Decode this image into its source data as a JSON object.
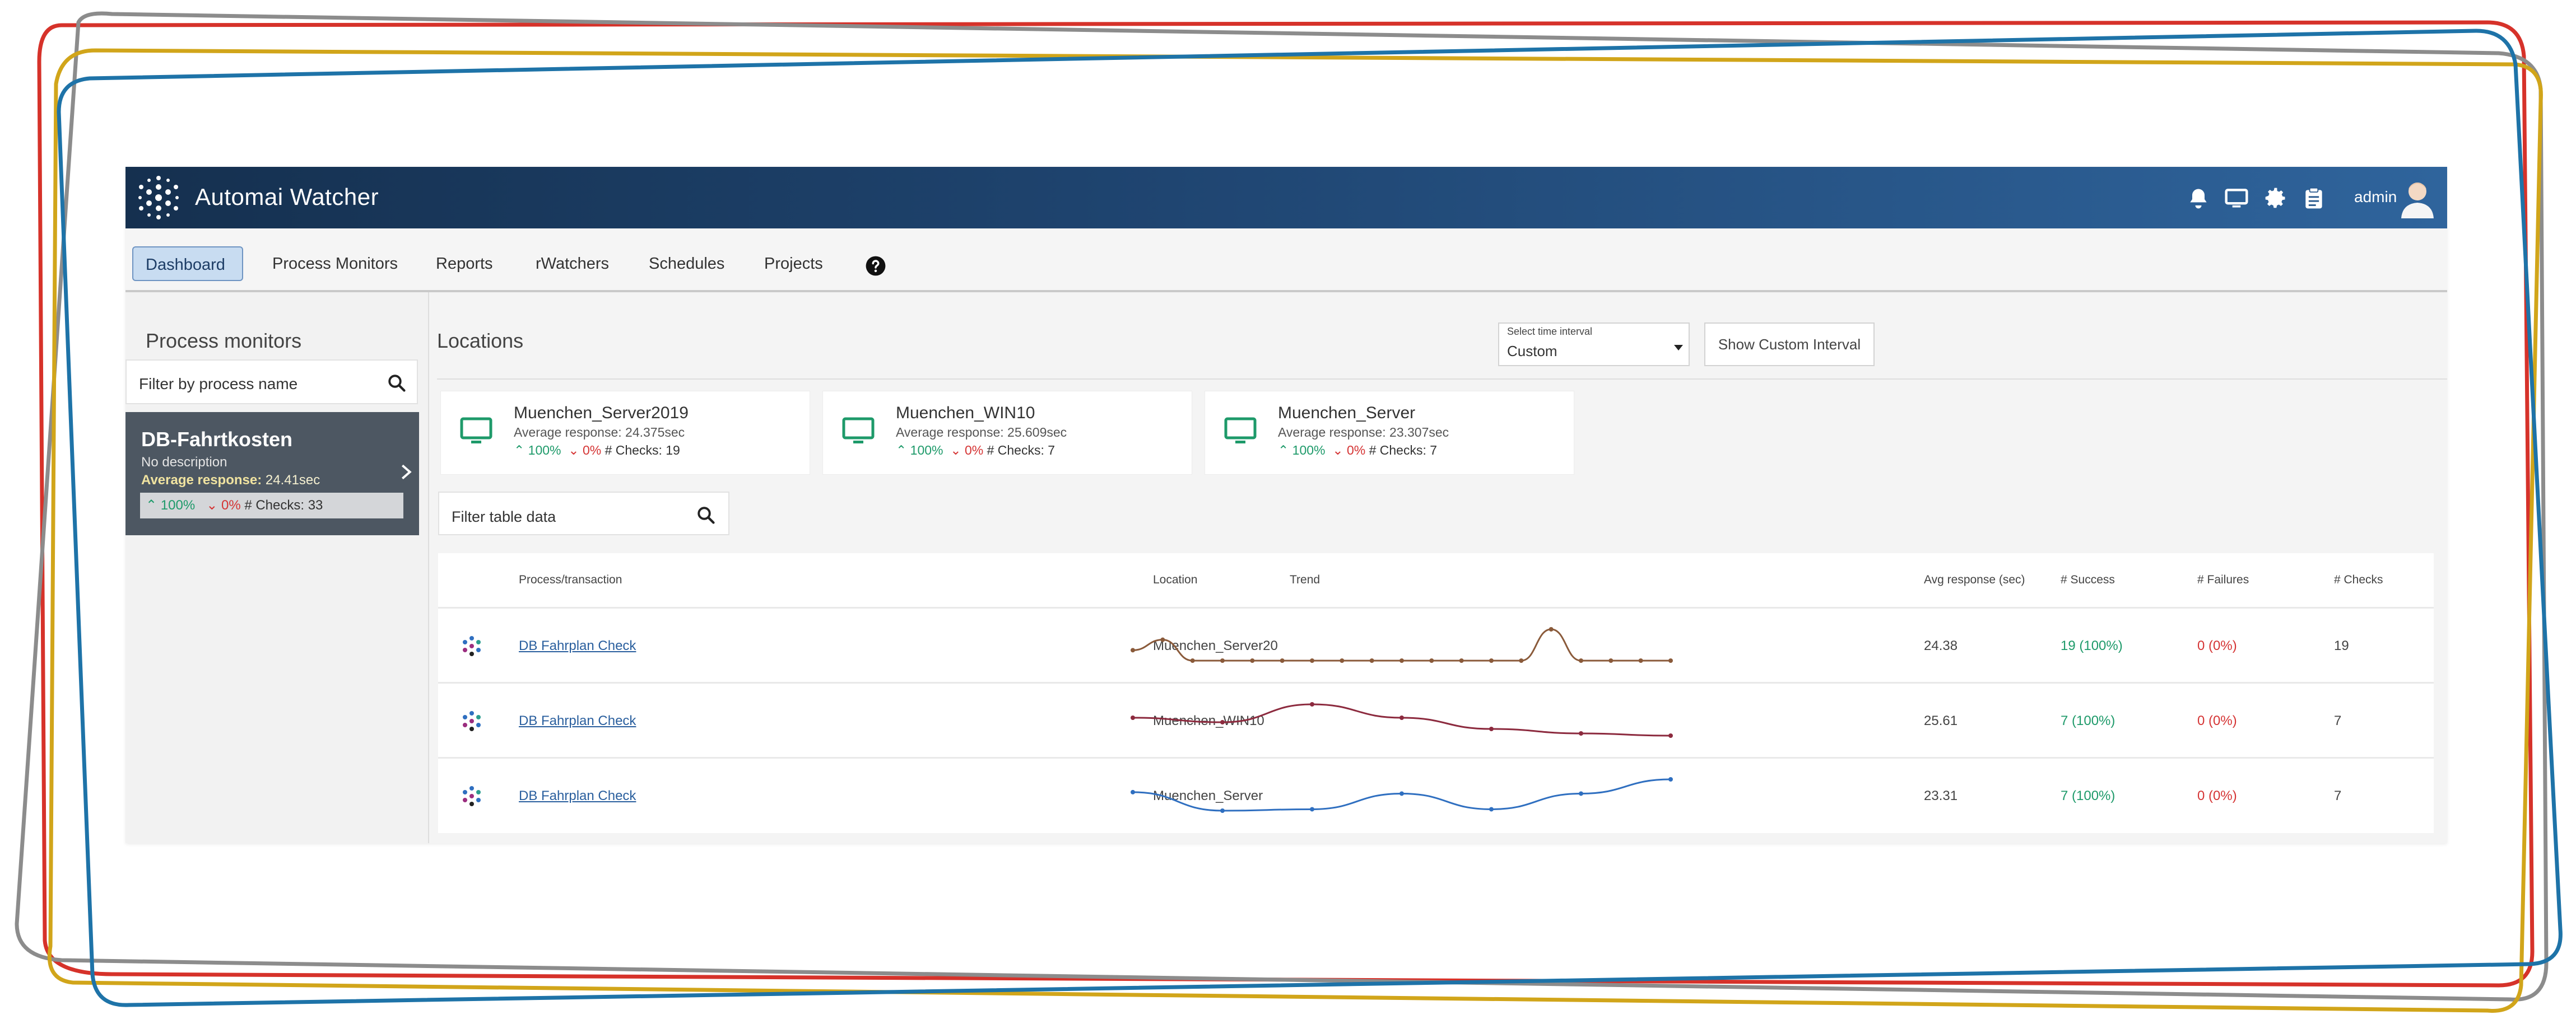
{
  "app": {
    "title": "Automai Watcher",
    "user": "admin"
  },
  "header_icons": [
    "bell-icon",
    "monitor-icon",
    "gear-icon",
    "clipboard-icon"
  ],
  "nav": {
    "items": [
      {
        "label": "Dashboard",
        "active": true
      },
      {
        "label": "Process Monitors",
        "active": false
      },
      {
        "label": "Reports",
        "active": false
      },
      {
        "label": "rWatchers",
        "active": false
      },
      {
        "label": "Schedules",
        "active": false
      },
      {
        "label": "Projects",
        "active": false
      }
    ],
    "help_icon": "question-circle-icon"
  },
  "process_monitors": {
    "title": "Process monitors",
    "filter_placeholder": "Filter by process name",
    "items": [
      {
        "name": "DB-Fahrtkosten",
        "description": "No description",
        "avg_label": "Average response:",
        "avg_value": "24.41sec",
        "success": "100%",
        "failure": "0%",
        "checks": "# Checks: 33"
      }
    ]
  },
  "locations": {
    "title": "Locations",
    "interval": {
      "label": "Select time interval",
      "value": "Custom"
    },
    "custom_button": "Show Custom Interval",
    "cards": [
      {
        "name": "Muenchen_Server2019",
        "avg": "Average response: 24.375sec",
        "success": "100%",
        "failure": "0%",
        "checks": "# Checks: 19"
      },
      {
        "name": "Muenchen_WIN10",
        "avg": "Average response: 25.609sec",
        "success": "100%",
        "failure": "0%",
        "checks": "# Checks: 7"
      },
      {
        "name": "Muenchen_Server",
        "avg": "Average response: 23.307sec",
        "success": "100%",
        "failure": "0%",
        "checks": "# Checks: 7"
      }
    ]
  },
  "table": {
    "filter_placeholder": "Filter table data",
    "headers": [
      "Process/transaction",
      "Location",
      "Trend",
      "Avg response (sec)",
      "# Success",
      "# Failures",
      "# Checks"
    ],
    "rows": [
      {
        "process": "DB Fahrplan Check",
        "location": "Muenchen_Server20",
        "avg": "24.38",
        "success": "19 (100%)",
        "failures": "0 (0%)",
        "checks": "19",
        "trend_color": "#8a5a3a",
        "trend": [
          26,
          28,
          24,
          24,
          24,
          24,
          24,
          24,
          24,
          24,
          24,
          24,
          24,
          24,
          30,
          24,
          24,
          24,
          24
        ]
      },
      {
        "process": "DB Fahrplan Check",
        "location": "Muenchen_WIN10",
        "avg": "25.61",
        "success": "7 (100%)",
        "failures": "0 (0%)",
        "checks": "7",
        "trend_color": "#8c2a3e",
        "trend": [
          26.0,
          25.6,
          27.2,
          26.0,
          25.0,
          24.6,
          24.4
        ]
      },
      {
        "process": "DB Fahrplan Check",
        "location": "Muenchen_Server",
        "avg": "23.31",
        "success": "7 (100%)",
        "failures": "0 (0%)",
        "checks": "7",
        "trend_color": "#2f6fc0",
        "trend": [
          23.3,
          22.0,
          22.1,
          23.2,
          22.1,
          23.2,
          24.2
        ]
      }
    ]
  }
}
